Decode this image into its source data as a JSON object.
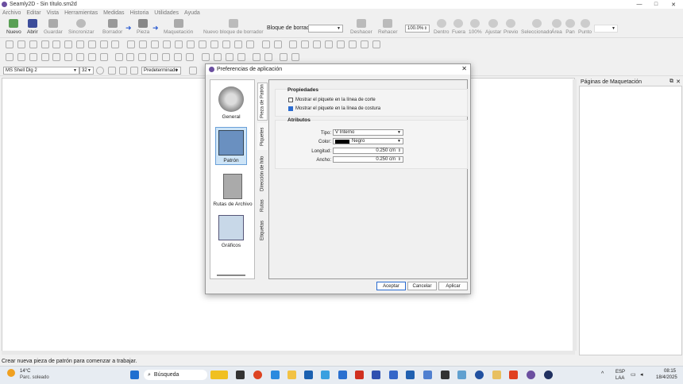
{
  "window": {
    "title": "Seamly2D - Sin título.sm2d",
    "minimize": "—",
    "maximize": "□",
    "close": "✕"
  },
  "menu": [
    "Archivo",
    "Editar",
    "Vista",
    "Herramientas",
    "Medidas",
    "Historia",
    "Utilidades",
    "Ayuda"
  ],
  "toolbar": {
    "nuevo": "Nuevo",
    "abrir": "Abrir",
    "guardar": "Guardar",
    "sincronizar": "Sincronizar",
    "borrador": "Borrador",
    "pieza": "Pieza",
    "maquetacion": "Maquetación",
    "nuevo_bloque": "Nuevo bloque de borrador",
    "bloque_label": "Bloque de borrador:",
    "bloque_value": "",
    "deshacer": "Deshacer",
    "rehacer": "Rehacer",
    "zoom_value": "100.0%",
    "dentro": "Dentro",
    "fuera": "Fuera",
    "cien": "100%",
    "ajustar": "Ajustar",
    "previo": "Previo",
    "seleccionado": "Seleccionado",
    "area": "Área",
    "pan": "Pan",
    "punto": "Punto"
  },
  "fontbar": {
    "font": "MS Shell Dlg 2",
    "size": "32",
    "mode": "Predeterminado"
  },
  "right_panel": {
    "title": "Páginas de Maquetación"
  },
  "status": "Crear nueva pieza de patrón para comenzar a trabajar.",
  "dialog": {
    "title": "Preferencias de aplicación",
    "categories": [
      {
        "label": "General"
      },
      {
        "label": "Patrón"
      },
      {
        "label": "Rutas de Archivo"
      },
      {
        "label": "Gráficos"
      }
    ],
    "tabs": [
      "Pieza de Patrón",
      "Piquetes",
      "Dirección de hilo",
      "Rutas",
      "Etiquetas"
    ],
    "propiedades": {
      "title": "Propiedades",
      "opt1": "Mostrar el piquete en la línea de corte",
      "opt1_checked": false,
      "opt2": "Mostrar el piquete en la línea de costura",
      "opt2_checked": true
    },
    "atributos": {
      "title": "Atributos",
      "tipo_label": "Tipo:",
      "tipo_value": "V Interno",
      "color_label": "Color:",
      "color_value": "Negro",
      "color_hex": "#000000",
      "longitud_label": "Longitud:",
      "longitud_value": "0.250 cm",
      "ancho_label": "Ancho:",
      "ancho_value": "0.250 cm"
    },
    "buttons": {
      "aceptar": "Aceptar",
      "cancelar": "Cancelar",
      "aplicar": "Aplicar"
    }
  },
  "taskbar": {
    "temp": "14°C",
    "weather": "Parc. soleado",
    "search": "Búsqueda",
    "lang1": "ESP",
    "lang2": "LAA",
    "time": "08:15",
    "date": "18/4/2025"
  }
}
